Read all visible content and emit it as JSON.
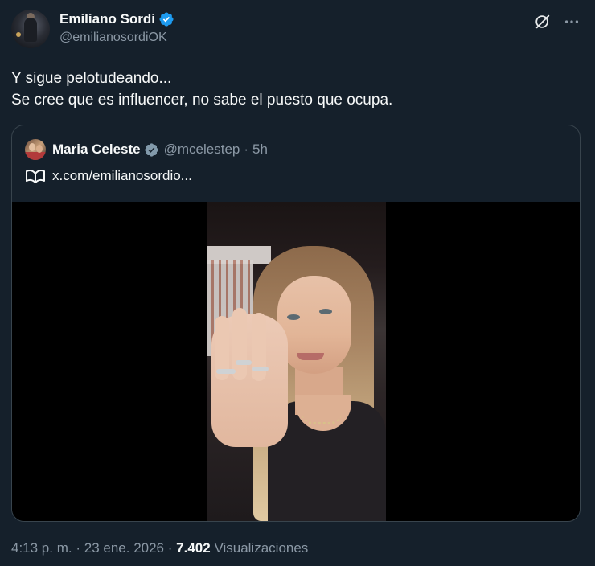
{
  "author": {
    "display_name": "Emiliano Sordi",
    "handle": "@emilianosordiOK",
    "verified": true,
    "verified_color": "#1d9bf0"
  },
  "actions": {
    "grok_icon": "grok-icon",
    "more_icon": "more-icon"
  },
  "tweet": {
    "lines": [
      "Y sigue pelotudeando...",
      "Se cree que es influencer, no sabe el puesto que ocupa."
    ]
  },
  "quote": {
    "display_name": "Maria Celeste",
    "verified": true,
    "handle": "@mcelestep",
    "separator": "·",
    "time": "5h",
    "link_icon": "link-icon",
    "link_text": "x.com/emilianosordio..."
  },
  "footer": {
    "time": "4:13 p. m.",
    "separator": "·",
    "date": "23 ene. 2026",
    "separator2": "·",
    "views_count": "7.402",
    "views_label": "Visualizaciones"
  }
}
